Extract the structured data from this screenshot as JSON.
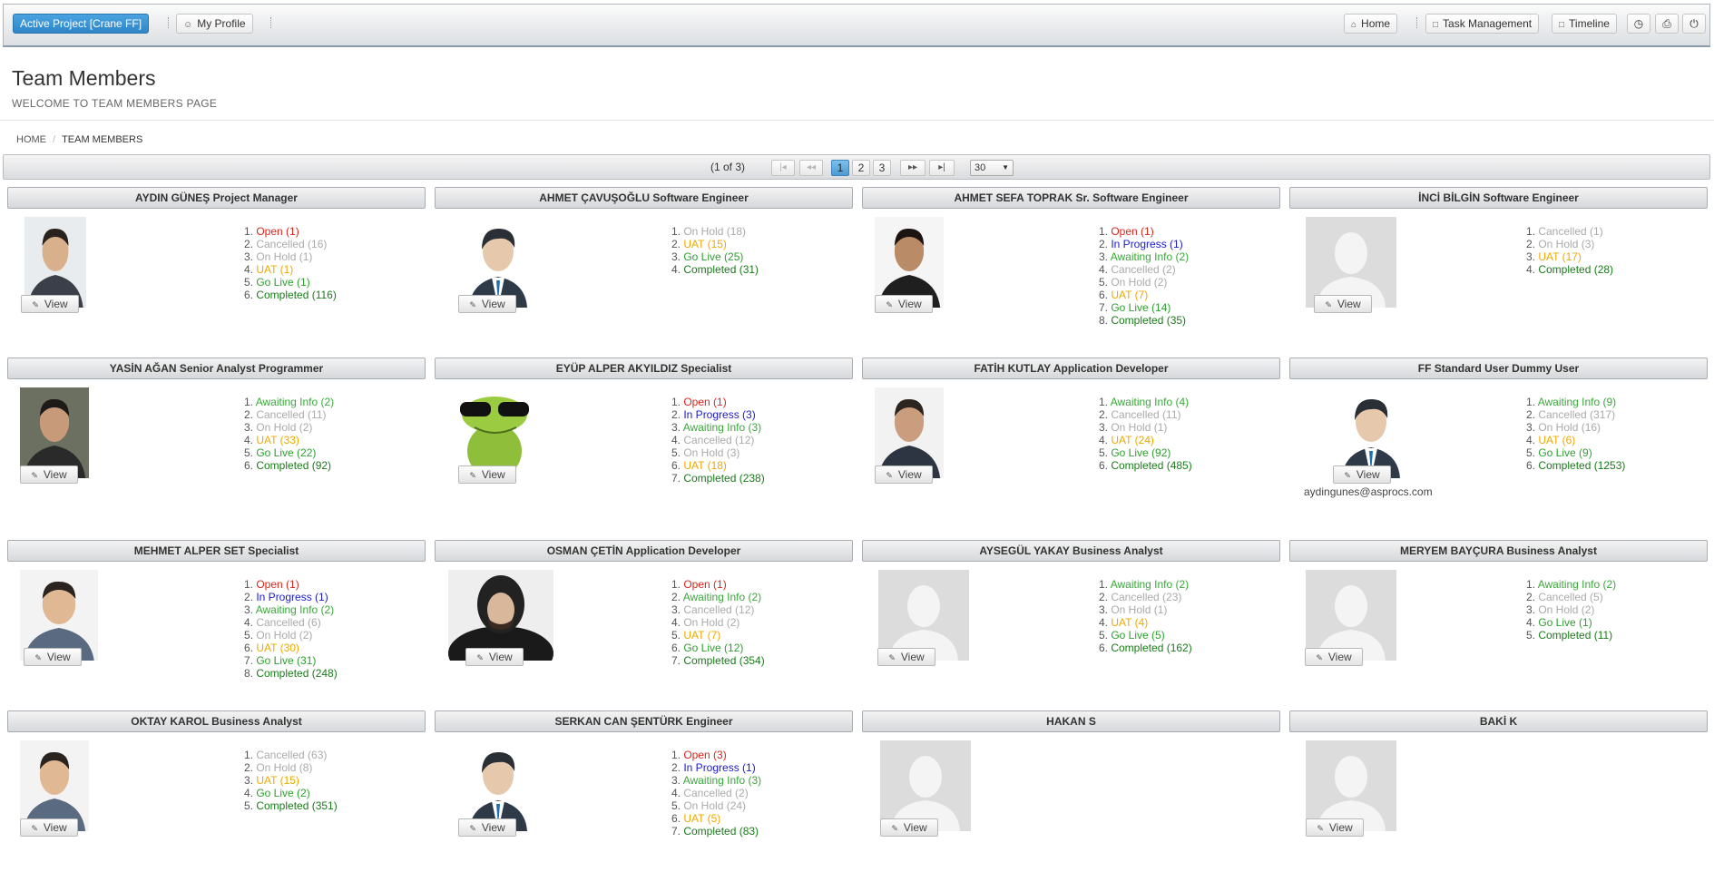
{
  "toolbar": {
    "active_project": "Active Project [Crane FF]",
    "my_profile": "My Profile",
    "home": "Home",
    "task_management": "Task Management",
    "timeline": "Timeline"
  },
  "page": {
    "title": "Team Members",
    "subtitle": "WELCOME TO TEAM MEMBERS PAGE"
  },
  "breadcrumb": {
    "home": "HOME",
    "current": "TEAM MEMBERS"
  },
  "paginator": {
    "report": "(1 of 3)",
    "pages": [
      "1",
      "2",
      "3"
    ],
    "current_page": "1",
    "rows_per_page": "30"
  },
  "view_label": "View",
  "members": [
    {
      "header": "AYDIN GÜNEŞ Project Manager",
      "statuses": [
        [
          "Open (1)",
          "open"
        ],
        [
          "Cancelled (16)",
          "cancel"
        ],
        [
          "On Hold (1)",
          "hold"
        ],
        [
          "UAT (1)",
          "uat"
        ],
        [
          "Go Live (1)",
          "golive"
        ],
        [
          "Completed (116)",
          "done"
        ]
      ]
    },
    {
      "header": "AHMET ÇAVUŞOĞLU Software Engineer",
      "statuses": [
        [
          "On Hold (18)",
          "hold"
        ],
        [
          "UAT (15)",
          "uat"
        ],
        [
          "Go Live (25)",
          "golive"
        ],
        [
          "Completed (31)",
          "done"
        ]
      ]
    },
    {
      "header": "AHMET SEFA TOPRAK Sr. Software Engineer",
      "statuses": [
        [
          "Open (1)",
          "open"
        ],
        [
          "In Progress (1)",
          "inprog"
        ],
        [
          "Awaiting Info (2)",
          "await"
        ],
        [
          "Cancelled (2)",
          "cancel"
        ],
        [
          "On Hold (2)",
          "hold"
        ],
        [
          "UAT (7)",
          "uat"
        ],
        [
          "Go Live (14)",
          "golive"
        ],
        [
          "Completed (35)",
          "done"
        ]
      ]
    },
    {
      "header": "İNCİ BİLGİN Software Engineer",
      "statuses": [
        [
          "Cancelled (1)",
          "cancel"
        ],
        [
          "On Hold (3)",
          "hold"
        ],
        [
          "UAT (17)",
          "uat"
        ],
        [
          "Completed (28)",
          "done"
        ]
      ]
    },
    {
      "header": "YASİN AĞAN Senior Analyst Programmer",
      "statuses": [
        [
          "Awaiting Info (2)",
          "await"
        ],
        [
          "Cancelled (11)",
          "cancel"
        ],
        [
          "On Hold (2)",
          "hold"
        ],
        [
          "UAT (33)",
          "uat"
        ],
        [
          "Go Live (22)",
          "golive"
        ],
        [
          "Completed (92)",
          "done"
        ]
      ]
    },
    {
      "header": "EYÜP ALPER AKYILDIZ Specialist",
      "statuses": [
        [
          "Open (1)",
          "open"
        ],
        [
          "In Progress (3)",
          "inprog"
        ],
        [
          "Awaiting Info (3)",
          "await"
        ],
        [
          "Cancelled (12)",
          "cancel"
        ],
        [
          "On Hold (3)",
          "hold"
        ],
        [
          "UAT (18)",
          "uat"
        ],
        [
          "Completed (238)",
          "done"
        ]
      ]
    },
    {
      "header": "FATİH KUTLAY Application Developer",
      "statuses": [
        [
          "Awaiting Info (4)",
          "await"
        ],
        [
          "Cancelled (11)",
          "cancel"
        ],
        [
          "On Hold (1)",
          "hold"
        ],
        [
          "UAT (24)",
          "uat"
        ],
        [
          "Go Live (92)",
          "golive"
        ],
        [
          "Completed (485)",
          "done"
        ]
      ]
    },
    {
      "header": "FF Standard User Dummy User",
      "email": "aydingunes@asprocs.com",
      "statuses": [
        [
          "Awaiting Info (9)",
          "await"
        ],
        [
          "Cancelled (317)",
          "cancel"
        ],
        [
          "On Hold (16)",
          "hold"
        ],
        [
          "UAT (6)",
          "uat"
        ],
        [
          "Go Live (9)",
          "golive"
        ],
        [
          "Completed (1253)",
          "done"
        ]
      ]
    },
    {
      "header": "MEHMET ALPER SET Specialist",
      "statuses": [
        [
          "Open (1)",
          "open"
        ],
        [
          "In Progress (1)",
          "inprog"
        ],
        [
          "Awaiting Info (2)",
          "await"
        ],
        [
          "Cancelled (6)",
          "cancel"
        ],
        [
          "On Hold (2)",
          "hold"
        ],
        [
          "UAT (30)",
          "uat"
        ],
        [
          "Go Live (31)",
          "golive"
        ],
        [
          "Completed (248)",
          "done"
        ]
      ]
    },
    {
      "header": "OSMAN ÇETİN Application Developer",
      "statuses": [
        [
          "Open (1)",
          "open"
        ],
        [
          "Awaiting Info (2)",
          "await"
        ],
        [
          "Cancelled (12)",
          "cancel"
        ],
        [
          "On Hold (2)",
          "hold"
        ],
        [
          "UAT (7)",
          "uat"
        ],
        [
          "Go Live (12)",
          "golive"
        ],
        [
          "Completed (354)",
          "done"
        ]
      ]
    },
    {
      "header": "AYSEGÜL YAKAY Business Analyst",
      "statuses": [
        [
          "Awaiting Info (2)",
          "await"
        ],
        [
          "Cancelled (23)",
          "cancel"
        ],
        [
          "On Hold (1)",
          "hold"
        ],
        [
          "UAT (4)",
          "uat"
        ],
        [
          "Go Live (5)",
          "golive"
        ],
        [
          "Completed (162)",
          "done"
        ]
      ]
    },
    {
      "header": "MERYEM BAYÇURA Business Analyst",
      "statuses": [
        [
          "Awaiting Info (2)",
          "await"
        ],
        [
          "Cancelled (5)",
          "cancel"
        ],
        [
          "On Hold (2)",
          "hold"
        ],
        [
          "Go Live (1)",
          "golive"
        ],
        [
          "Completed (11)",
          "done"
        ]
      ]
    },
    {
      "header": "OKTAY KAROL Business Analyst",
      "statuses": [
        [
          "Cancelled (63)",
          "cancel"
        ],
        [
          "On Hold (8)",
          "hold"
        ],
        [
          "UAT (15)",
          "uat"
        ],
        [
          "Go Live (2)",
          "golive"
        ],
        [
          "Completed (351)",
          "done"
        ]
      ]
    },
    {
      "header": "SERKAN CAN ŞENTÜRK Engineer",
      "statuses": [
        [
          "Open (3)",
          "open"
        ],
        [
          "In Progress (1)",
          "inprog"
        ],
        [
          "Awaiting Info (3)",
          "await"
        ],
        [
          "Cancelled (2)",
          "cancel"
        ],
        [
          "On Hold (24)",
          "hold"
        ],
        [
          "UAT (5)",
          "uat"
        ],
        [
          "Completed (83)",
          "done"
        ]
      ]
    },
    {
      "header": "HAKAN S",
      "statuses": []
    },
    {
      "header": "BAKİ K",
      "statuses": []
    }
  ],
  "colors": {
    "open": "#d9261c",
    "in_progress": "#1a1acf",
    "awaiting_info": "#3aa83a",
    "cancelled": "#aaaaaa",
    "on_hold": "#aaaaaa",
    "uat": "#f0a800",
    "go_live": "#2f9e2f",
    "completed": "#1b7a1b",
    "primary_button": "#2f86c8"
  }
}
